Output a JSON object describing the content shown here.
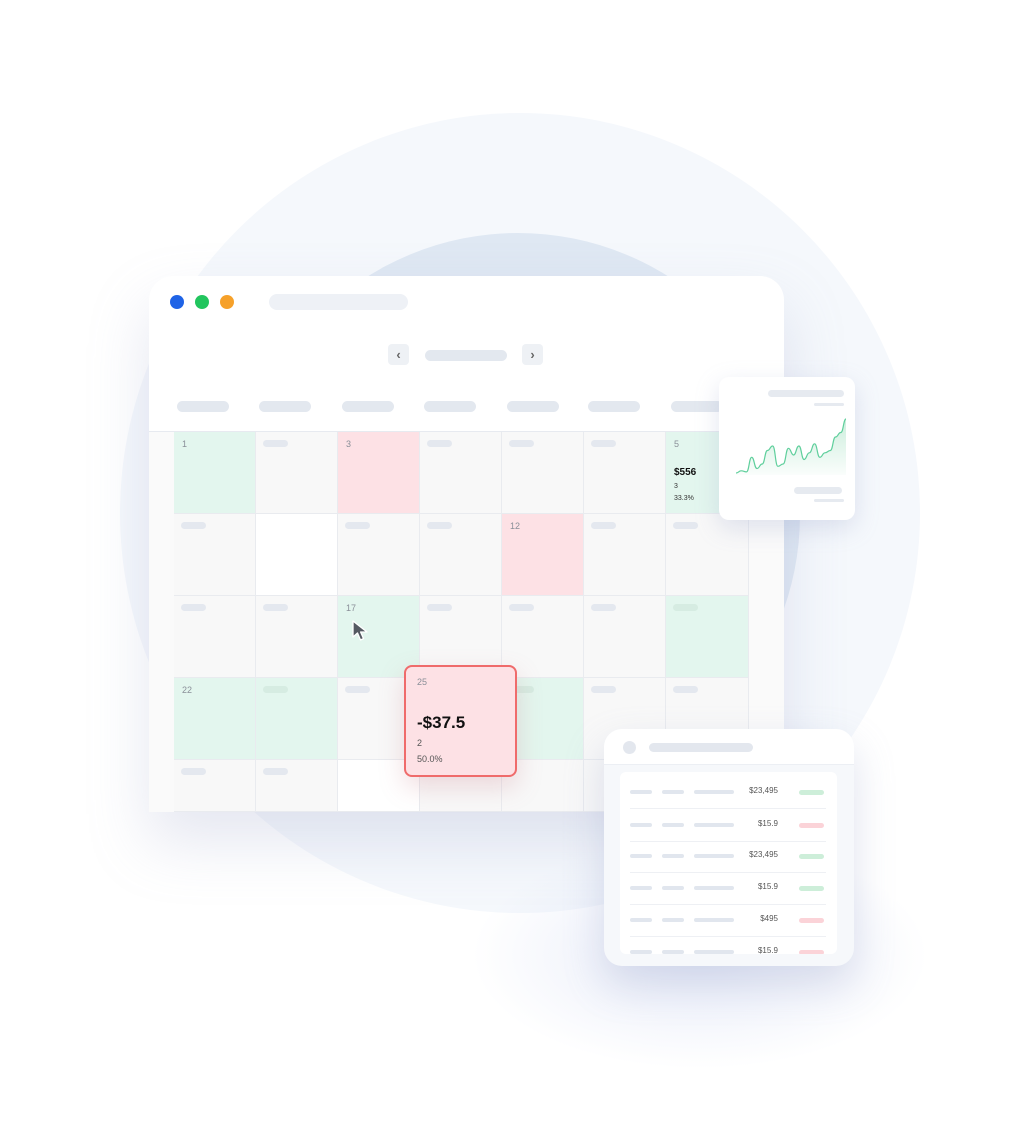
{
  "calendar": {
    "nav": {
      "prev_icon": "chevron-left-icon",
      "next_icon": "chevron-right-icon",
      "prev_glyph": "‹",
      "next_glyph": "›"
    },
    "window_dots": [
      {
        "name": "window-dot-blue",
        "color": "#1f63e6"
      },
      {
        "name": "window-dot-green",
        "color": "#22c55e"
      },
      {
        "name": "window-dot-orange",
        "color": "#f6a12a"
      }
    ],
    "colors": {
      "profit": "#e3f6ee",
      "loss": "#fde1e5"
    },
    "days": {
      "d1": "1",
      "d3": "3",
      "d5": "5",
      "d12": "12",
      "d17": "17",
      "d22": "22"
    },
    "day5": {
      "amount": "$556",
      "count": "3",
      "percent": "33.3%"
    }
  },
  "popup": {
    "day": "25",
    "amount": "-$37.5",
    "count": "2",
    "percent": "50.0%"
  },
  "chart_card": {
    "chart_data": {
      "type": "area",
      "title": "",
      "values": [
        2,
        3,
        2.5,
        9,
        4,
        6,
        12,
        14,
        5,
        6,
        13,
        10,
        14,
        8,
        11,
        15,
        9,
        11,
        12,
        18,
        20,
        26
      ]
    },
    "colors": {
      "line": "#5fcf9c",
      "fill": "#cdeedd"
    }
  },
  "table_card": {
    "rows": [
      {
        "amount": "$23,495",
        "status": "positive"
      },
      {
        "amount": "$15.9",
        "status": "negative"
      },
      {
        "amount": "$23,495",
        "status": "positive"
      },
      {
        "amount": "$15.9",
        "status": "positive"
      },
      {
        "amount": "$495",
        "status": "negative"
      },
      {
        "amount": "$15.9",
        "status": "negative"
      }
    ],
    "status_colors": {
      "positive": "#cdeed9",
      "negative": "#fbd3d8"
    }
  }
}
